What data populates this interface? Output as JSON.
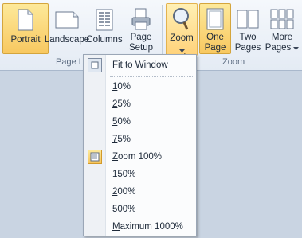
{
  "ribbon": {
    "buttons": {
      "portrait": "Portrait",
      "landscape": "Landscape",
      "columns": "Columns",
      "page_setup": [
        "Page",
        "Setup"
      ],
      "zoom": "Zoom",
      "one_page": [
        "One",
        "Page"
      ],
      "two_pages": [
        "Two",
        "Pages"
      ],
      "more_pages": [
        "More",
        "Pages"
      ]
    },
    "groups": {
      "page_layout": "Page L",
      "zoom": "Zoom"
    }
  },
  "zoom_menu": {
    "items": [
      {
        "label": "Fit to Window",
        "icon": "fit-to-window-icon"
      },
      {
        "prefix": "",
        "accel": "1",
        "rest": "0%"
      },
      {
        "prefix": "",
        "accel": "2",
        "rest": "5%"
      },
      {
        "prefix": "",
        "accel": "5",
        "rest": "0%"
      },
      {
        "prefix": "",
        "accel": "7",
        "rest": "5%"
      },
      {
        "prefix": "",
        "accel": "Z",
        "rest": "oom 100%",
        "checked": true
      },
      {
        "prefix": "",
        "accel": "1",
        "rest": "50%"
      },
      {
        "prefix": "",
        "accel": "2",
        "rest": "00%"
      },
      {
        "prefix": "",
        "accel": "5",
        "rest": "00%"
      },
      {
        "prefix": "",
        "accel": "M",
        "rest": "aximum 1000%"
      }
    ]
  },
  "colors": {
    "active_button": "#f8c860",
    "ribbon_bg": "#e4ebf4",
    "page_bg": "#c9d4e2"
  }
}
